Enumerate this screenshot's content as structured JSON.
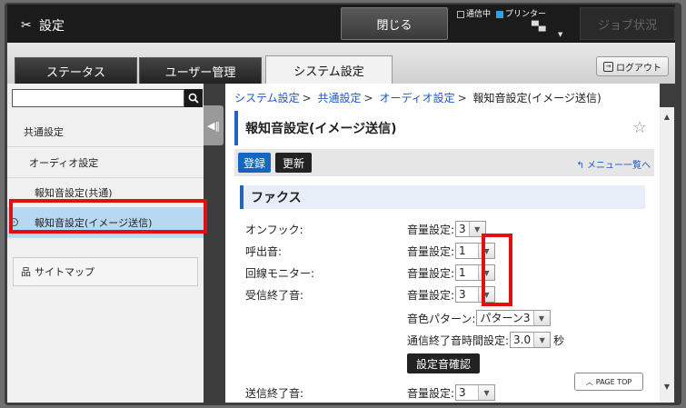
{
  "topbar": {
    "title": "設定",
    "close_label": "閉じる",
    "status_comm": "通信中",
    "status_printer": "プリンター",
    "job_label": "ジョブ状況"
  },
  "tabs": [
    {
      "label": "ステータス",
      "active": false
    },
    {
      "label": "ユーザー管理",
      "active": false
    },
    {
      "label": "システム設定",
      "active": true
    }
  ],
  "logout_label": "ログアウト",
  "sidebar": {
    "search_placeholder": "",
    "items": [
      {
        "label": "共通設定"
      },
      {
        "label": "オーディオ設定"
      },
      {
        "label": "報知音設定(共通)"
      },
      {
        "label": "報知音設定(イメージ送信)",
        "selected": true
      }
    ],
    "sitemap_label": "サイトマップ"
  },
  "breadcrumb": {
    "items": [
      "システム設定",
      "共通設定",
      "オーディオ設定"
    ],
    "current": "報知音設定(イメージ送信)",
    "sep": ">"
  },
  "page_title": "報知音設定(イメージ送信)",
  "toolbar": {
    "register_label": "登録",
    "update_label": "更新",
    "menu_back_label": "メニュー一覧へ"
  },
  "section_title": "ファクス",
  "rows": [
    {
      "label": "オンフック:",
      "field": "音量設定:",
      "value": "3"
    },
    {
      "label": "呼出音:",
      "field": "音量設定:",
      "value": "1"
    },
    {
      "label": "回線モニター:",
      "field": "音量設定:",
      "value": "1"
    },
    {
      "label": "受信終了音:",
      "field": "音量設定:",
      "value": "3"
    }
  ],
  "tone_pattern": {
    "field": "音色パターン:",
    "value": "パターン3"
  },
  "end_time": {
    "field": "通信終了音時間設定:",
    "value": "3.0",
    "unit": "秒"
  },
  "confirm_label": "設定音確認",
  "page_top_label": "PAGE TOP",
  "send_end": {
    "label": "送信終了音:",
    "field": "音量設定:",
    "value": "3"
  },
  "colors": {
    "accent": "#1466c0",
    "highlight": "#e01010",
    "selected": "#b8d8f2"
  }
}
